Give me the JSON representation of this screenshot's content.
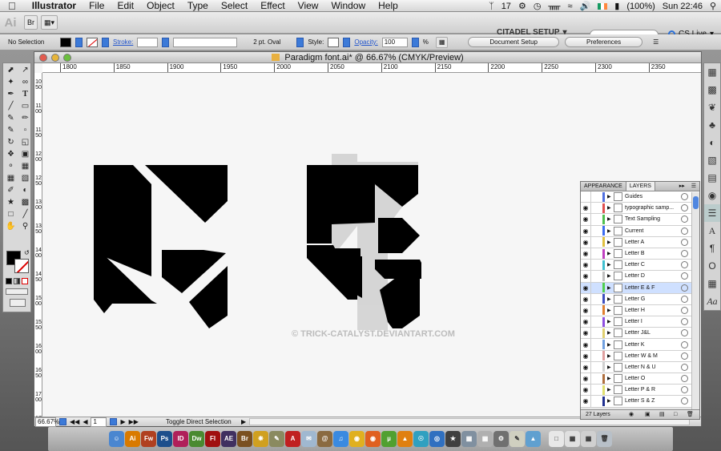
{
  "menubar": {
    "app_name": "Illustrator",
    "items": [
      "File",
      "Edit",
      "Object",
      "Type",
      "Select",
      "Effect",
      "View",
      "Window",
      "Help"
    ],
    "battery": "(100%)",
    "clock": "Sun 22:46",
    "num_badge": "17"
  },
  "appbar": {
    "logo": "Ai",
    "workspace": "CITADEL SETUP",
    "cs_live": "CS Live"
  },
  "control": {
    "selection": "No Selection",
    "stroke_label": "Stroke:",
    "brush": "2 pt. Oval",
    "style_label": "Style:",
    "opacity_label": "Opacity:",
    "opacity_value": "100",
    "opacity_unit": "%",
    "document_setup": "Document Setup",
    "preferences": "Preferences"
  },
  "document": {
    "title": "Paradigm font.ai* @ 66.67% (CMYK/Preview)",
    "ruler_h": [
      "1800",
      "1850",
      "1900",
      "1950",
      "2000",
      "2050",
      "2100",
      "2150",
      "2200",
      "2250",
      "2300",
      "2350"
    ],
    "ruler_v": [
      "1050",
      "1100",
      "1150",
      "1200",
      "1250",
      "1300",
      "1350",
      "1400",
      "1450",
      "1500",
      "1550",
      "1600",
      "1650",
      "1700",
      "1750"
    ],
    "zoom": "66.67%",
    "page": "1",
    "status_tool": "Toggle Direct Selection",
    "watermark": "© TRICK-CATALYST.DEVIANTART.COM"
  },
  "layers_panel": {
    "tab_appearance": "APPEARANCE",
    "tab_layers": "LAYERS",
    "footer": "27 Layers",
    "rows": [
      {
        "name": "Guides",
        "color": "#4f6fe0",
        "eye": false
      },
      {
        "name": "typographic samp...",
        "color": "#e05050",
        "eye": true
      },
      {
        "name": "Text Sampling",
        "color": "#50c050",
        "eye": true
      },
      {
        "name": "Current",
        "color": "#3c6cf0",
        "eye": true
      },
      {
        "name": "Letter A",
        "color": "#e0c040",
        "eye": true
      },
      {
        "name": "Letter B",
        "color": "#c040c0",
        "eye": true
      },
      {
        "name": "Letter C",
        "color": "#40c0d0",
        "eye": true
      },
      {
        "name": "Letter D",
        "color": "#c0c0c0",
        "eye": true
      },
      {
        "name": "Letter E & F",
        "color": "#50d050",
        "eye": true,
        "selected": true
      },
      {
        "name": "Letter G",
        "color": "#4050c0",
        "eye": true
      },
      {
        "name": "Letter H",
        "color": "#e08030",
        "eye": true
      },
      {
        "name": "Letter I",
        "color": "#9050e0",
        "eye": true
      },
      {
        "name": "Letter J&L",
        "color": "#e0d070",
        "eye": true
      },
      {
        "name": "Letter K",
        "color": "#70a0e0",
        "eye": true
      },
      {
        "name": "Letter W & M",
        "color": "#e0a0a0",
        "eye": true
      },
      {
        "name": "Letter N & U",
        "color": "#d0d0d0",
        "eye": true
      },
      {
        "name": "Letter O",
        "color": "#b07040",
        "eye": true
      },
      {
        "name": "Letter P & R",
        "color": "#e0e070",
        "eye": true
      },
      {
        "name": "Letter S & Z",
        "color": "#203090",
        "eye": true
      }
    ]
  }
}
